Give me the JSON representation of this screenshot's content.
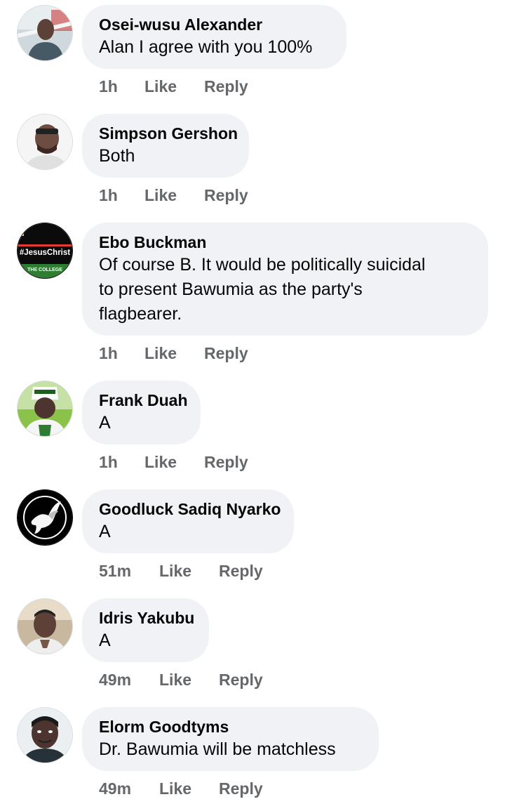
{
  "comments": [
    {
      "author": "Osei-wusu Alexander",
      "text": "Alan I agree with you 100%",
      "time": "1h",
      "like_label": "Like",
      "reply_label": "Reply",
      "avatar_icon": "user-photo-icon"
    },
    {
      "author": "Simpson Gershon",
      "text": "Both",
      "time": "1h",
      "like_label": "Like",
      "reply_label": "Reply",
      "avatar_icon": "user-photo-icon"
    },
    {
      "author": "Ebo Buckman",
      "text": "Of course B. It would be politically suicidal\nto present Bawumia as the party's\nflagbearer.",
      "time": "1h",
      "like_label": "Like",
      "reply_label": "Reply",
      "avatar_icon": "jesuschrist-logo-icon",
      "avatar_text": "#JesusChrist",
      "avatar_subtext": "THE COLLEGE"
    },
    {
      "author": "Frank Duah",
      "text": "A",
      "time": "1h",
      "like_label": "Like",
      "reply_label": "Reply",
      "avatar_icon": "user-photo-icon"
    },
    {
      "author": "Goodluck Sadiq Nyarko",
      "text": "A",
      "time": "51m",
      "like_label": "Like",
      "reply_label": "Reply",
      "avatar_icon": "white-dove-icon"
    },
    {
      "author": "Idris Yakubu",
      "text": "A",
      "time": "49m",
      "like_label": "Like",
      "reply_label": "Reply",
      "avatar_icon": "user-photo-icon"
    },
    {
      "author": "Elorm Goodtyms",
      "text": "Dr. Bawumia will be matchless",
      "time": "49m",
      "like_label": "Like",
      "reply_label": "Reply",
      "avatar_icon": "user-photo-icon"
    }
  ],
  "colors": {
    "bubble_background": "#f0f2f5",
    "author_text": "#050505",
    "meta_text": "#65676b",
    "page_background": "#ffffff"
  }
}
